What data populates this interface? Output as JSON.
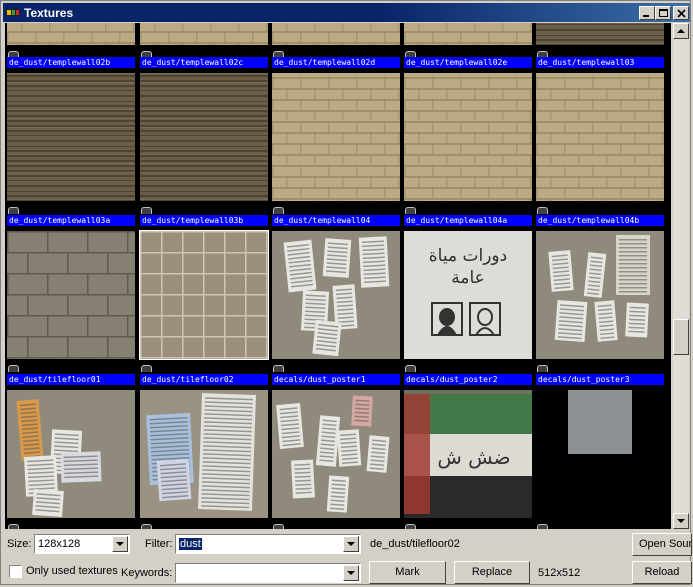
{
  "window": {
    "title": "Textures"
  },
  "textures": [
    {
      "name": "de_dust/templewall02b",
      "kind": "sand",
      "cut": true
    },
    {
      "name": "de_dust/templewall02c",
      "kind": "sand",
      "cut": true
    },
    {
      "name": "de_dust/templewall02d",
      "kind": "sand",
      "cut": true
    },
    {
      "name": "de_dust/templewall02e",
      "kind": "sand",
      "cut": true
    },
    {
      "name": "de_dust/templewall03",
      "kind": "darkbrick",
      "cut": true
    },
    {
      "name": "de_dust/templewall03a",
      "kind": "darkbrick"
    },
    {
      "name": "de_dust/templewall03b",
      "kind": "darkbrick"
    },
    {
      "name": "de_dust/templewall04",
      "kind": "sand"
    },
    {
      "name": "de_dust/templewall04a",
      "kind": "sand"
    },
    {
      "name": "de_dust/templewall04b",
      "kind": "sand"
    },
    {
      "name": "de_dust/tilefloor01",
      "kind": "stone"
    },
    {
      "name": "de_dust/tilefloor02",
      "kind": "tiles",
      "selected": true
    },
    {
      "name": "decals/dust_poster1",
      "kind": "poster1"
    },
    {
      "name": "decals/dust_poster2",
      "kind": "sign"
    },
    {
      "name": "decals/dust_poster3",
      "kind": "poster3"
    },
    {
      "name": "",
      "kind": "poster4"
    },
    {
      "name": "",
      "kind": "poster5"
    },
    {
      "name": "",
      "kind": "poster6"
    },
    {
      "name": "",
      "kind": "flag"
    },
    {
      "name": "",
      "kind": "small"
    }
  ],
  "sign_text": {
    "line1": "دورات مياة",
    "line2": "عامة"
  },
  "graffiti_text": "ضش ش",
  "bottom": {
    "size_label": "Size:",
    "size_value": "128x128",
    "filter_label": "Filter:",
    "filter_value": "dust",
    "selected_texture": "de_dust/tilefloor02",
    "open_source_button": "Open Source",
    "only_used_label": "Only used textures",
    "keywords_label": "Keywords:",
    "keywords_value": "",
    "mark_button": "Mark",
    "replace_button": "Replace",
    "dimensions": "512x512",
    "reload_button": "Reload"
  }
}
